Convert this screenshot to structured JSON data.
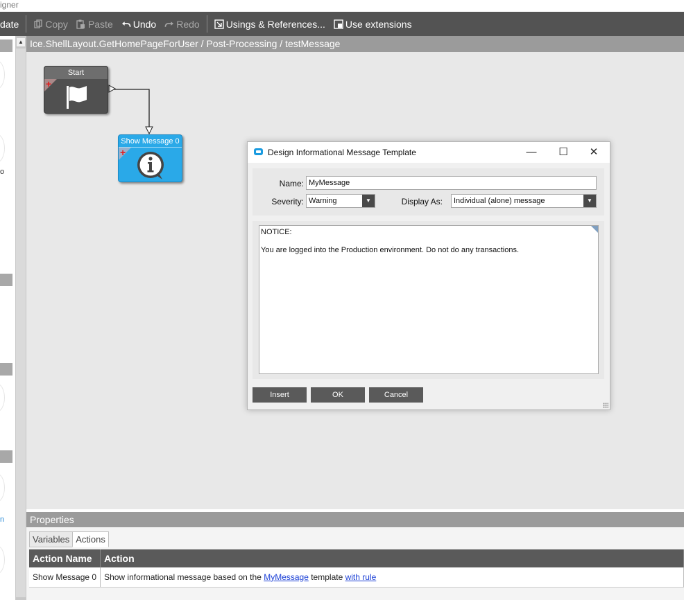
{
  "window": {
    "title_fragment": "igner"
  },
  "toolbar": {
    "update_label": "date",
    "copy_label": "Copy",
    "paste_label": "Paste",
    "undo_label": "Undo",
    "redo_label": "Redo",
    "usings_label": "Usings & References...",
    "extensions_label": "Use extensions"
  },
  "breadcrumb": "Ice.ShellLayout.GetHomePageForUser / Post-Processing / testMessage",
  "workflow": {
    "start_node": {
      "label": "Start",
      "icon": "flag-icon"
    },
    "message_node": {
      "label": "Show Message 0",
      "icon": "info-speech-icon",
      "color": "#29a9e8"
    }
  },
  "left_panel": {
    "fragment_1": "o",
    "fragment_2": "n"
  },
  "dialog": {
    "title": "Design Informational Message Template",
    "name_label": "Name:",
    "name_value": "MyMessage",
    "severity_label": "Severity:",
    "severity_value": "Warning",
    "display_label": "Display As:",
    "display_value": "Individual (alone) message",
    "message_line1": "NOTICE:",
    "message_line2": "You are logged into the Production environment. Do not do any transactions.",
    "insert_label": "Insert",
    "ok_label": "OK",
    "cancel_label": "Cancel",
    "minimize_glyph": "—",
    "maximize_glyph": "☐",
    "close_glyph": "✕"
  },
  "properties": {
    "title": "Properties",
    "tabs": [
      "Variables",
      "Actions"
    ],
    "active_tab": "Actions",
    "columns": [
      "Action Name",
      "Action"
    ],
    "rows": [
      {
        "name": "Show Message 0",
        "action_prefix": "Show informational message based on the ",
        "action_link1": "MyMessage",
        "action_middle": " template ",
        "action_link2": "with rule"
      }
    ]
  }
}
